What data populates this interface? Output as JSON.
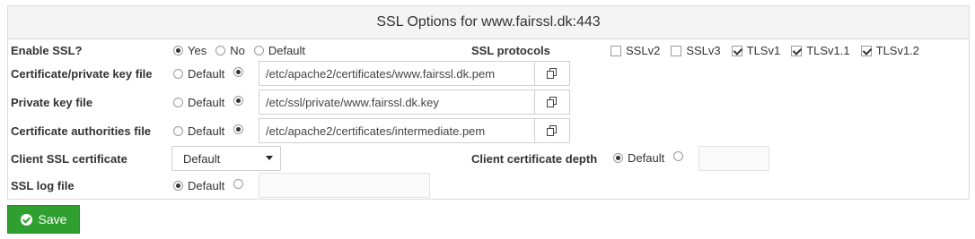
{
  "panel": {
    "title": "SSL Options for www.fairssl.dk:443"
  },
  "enable_ssl": {
    "label": "Enable SSL?",
    "options": [
      "Yes",
      "No",
      "Default"
    ],
    "selected": "Yes"
  },
  "ssl_protocols": {
    "label": "SSL protocols",
    "items": [
      {
        "label": "SSLv2",
        "checked": false
      },
      {
        "label": "SSLv3",
        "checked": false
      },
      {
        "label": "TLSv1",
        "checked": true
      },
      {
        "label": "TLSv1.1",
        "checked": true
      },
      {
        "label": "TLSv1.2",
        "checked": true
      }
    ]
  },
  "cert_key_file": {
    "label": "Certificate/private key file",
    "default_label": "Default",
    "value": "/etc/apache2/certificates/www.fairssl.dk.pem"
  },
  "private_key_file": {
    "label": "Private key file",
    "default_label": "Default",
    "value": "/etc/ssl/private/www.fairssl.dk.key"
  },
  "ca_file": {
    "label": "Certificate authorities file",
    "default_label": "Default",
    "value": "/etc/apache2/certificates/intermediate.pem"
  },
  "client_cert": {
    "label": "Client SSL certificate",
    "selected": "Default"
  },
  "client_depth": {
    "label": "Client certificate depth",
    "default_label": "Default",
    "value": ""
  },
  "ssl_log": {
    "label": "SSL log file",
    "default_label": "Default",
    "value": ""
  },
  "save": {
    "label": "Save"
  },
  "icons": {
    "file_chooser": "file-chooser-icon",
    "dropdown": "caret-down-icon",
    "save": "check-circle-icon"
  },
  "colors": {
    "save_button": "#2fa02f",
    "header_bg": "#f4f4f4"
  }
}
